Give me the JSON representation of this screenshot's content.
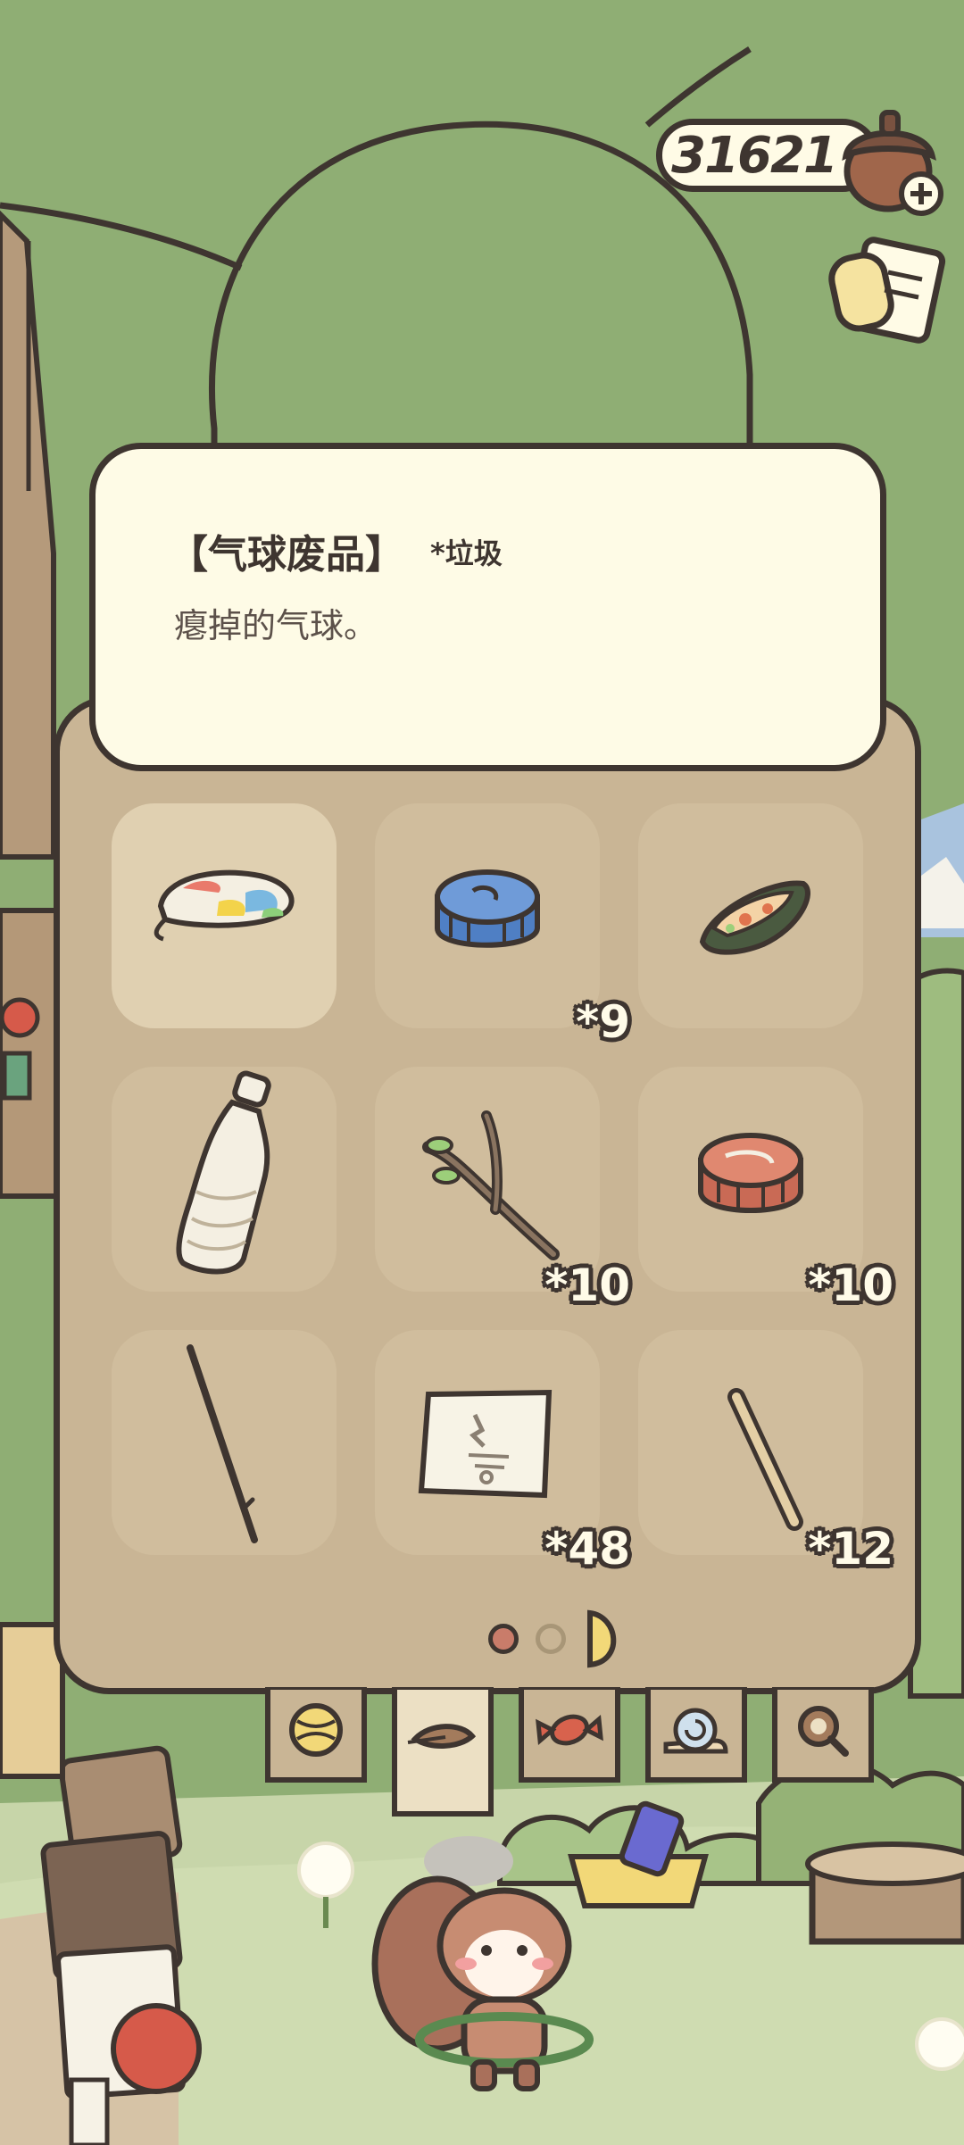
{
  "currency": {
    "amount": "31621",
    "icon": "acorn-icon",
    "add_icon": "plus-icon"
  },
  "top_buttons": {
    "notes_icon": "notes-icon"
  },
  "item_detail": {
    "name": "【气球废品】",
    "category": "*垃圾",
    "description": "瘪掉的气球。"
  },
  "inventory": {
    "slots": [
      {
        "item": "deflated-balloon",
        "count": "",
        "selected": true
      },
      {
        "item": "blue-bottle-cap",
        "count": "*9",
        "selected": false
      },
      {
        "item": "food-wrapper",
        "count": "",
        "selected": false
      },
      {
        "item": "plastic-bottle",
        "count": "",
        "selected": false
      },
      {
        "item": "twig",
        "count": "*10",
        "selected": false
      },
      {
        "item": "red-bottle-cap",
        "count": "*10",
        "selected": false
      },
      {
        "item": "thin-stick",
        "count": "",
        "selected": false
      },
      {
        "item": "paper-scrap",
        "count": "*48",
        "selected": false
      },
      {
        "item": "straw",
        "count": "*12",
        "selected": false
      }
    ],
    "pages": {
      "current": 1,
      "total": 3
    }
  },
  "category_tabs": [
    {
      "icon": "yarn-icon",
      "active": false
    },
    {
      "icon": "leaf-icon",
      "active": true
    },
    {
      "icon": "candy-icon",
      "active": false
    },
    {
      "icon": "snail-icon",
      "active": false
    },
    {
      "icon": "magnifier-icon",
      "active": false
    }
  ],
  "colors": {
    "outline": "#3e3530",
    "panel": "#c9b595",
    "card": "#fefbe6",
    "grass": "#8fae74"
  }
}
